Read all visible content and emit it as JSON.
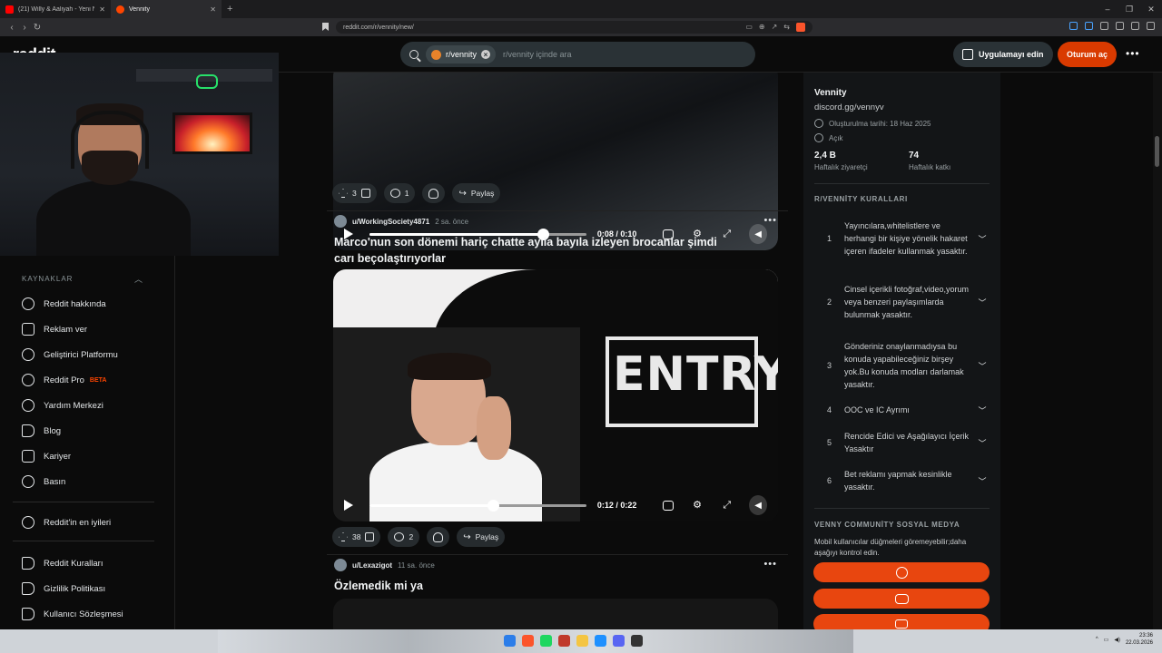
{
  "browser": {
    "tabs": [
      {
        "title": "(21) Willy & Aaliyah - Yeni Nesil Billio",
        "active": false,
        "favicon": "youtube-icon"
      },
      {
        "title": "Vennity",
        "active": true,
        "favicon": "reddit-icon"
      }
    ],
    "url": "reddit.com/r/vennity/new/"
  },
  "header": {
    "logo": "reddit",
    "search_chip": "r/vennity",
    "search_placeholder": "r/vennity içinde ara",
    "get_app": "Uygulamayı edin",
    "login": "Oturum aç"
  },
  "sidebar": {
    "section": "KAYNAKLAR",
    "items": [
      {
        "label": "Reddit hakkında",
        "icon": "reddit-alien-icon"
      },
      {
        "label": "Reklam ver",
        "icon": "megaphone-icon"
      },
      {
        "label": "Geliştirici Platformu",
        "icon": "dev-platform-icon"
      },
      {
        "label": "Reddit Pro",
        "badge": "BETA",
        "icon": "pro-icon"
      },
      {
        "label": "Yardım Merkezi",
        "icon": "help-icon"
      },
      {
        "label": "Blog",
        "icon": "book-icon"
      },
      {
        "label": "Kariyer",
        "icon": "briefcase-icon"
      },
      {
        "label": "Basın",
        "icon": "press-icon"
      }
    ],
    "best_of": "Reddit'in en iyileri",
    "legal": [
      "Reddit Kuralları",
      "Gizlilik Politikası",
      "Kullanıcı Sözleşmesi"
    ]
  },
  "posts": [
    {
      "time": "0:08 / 0:10",
      "progress": 0.8,
      "votes": "3",
      "comments": "1",
      "share": "Paylaş"
    },
    {
      "author": "u/WorkingSociety4871",
      "age": "2 sa. önce",
      "title": "Marco'nun son dönemi hariç chatte ayıla bayıla izleyen brocanlar şimdi carı beçolaştırıyorlar",
      "video_text": "ENTRY",
      "time": "0:12 / 0:22",
      "progress": 0.57,
      "votes": "38",
      "comments": "2",
      "share": "Paylaş"
    },
    {
      "author": "u/Lexazigot",
      "age": "11 sa. önce",
      "title": "Özlemedik mi ya"
    }
  ],
  "community": {
    "name": "Vennity",
    "description": "discord.gg/vennyv",
    "created": "Oluşturulma tarihi: 18 Haz 2025",
    "visibility": "Açık",
    "stats": [
      {
        "value": "2,4 B",
        "label": "Haftalık ziyaretçi"
      },
      {
        "value": "74",
        "label": "Haftalık katkı"
      }
    ],
    "rules_heading": "R/VENNİTY KURALLARI",
    "rules": [
      {
        "num": "1",
        "text": "Yayıncılara,whitelistlere ve herhangi bir kişiye yönelik hakaret içeren ifadeler kullanmak yasaktır."
      },
      {
        "num": "2",
        "text": "Cinsel içerikli fotoğraf,video,yorum veya benzeri paylaşımlarda bulunmak yasaktır."
      },
      {
        "num": "3",
        "text": "Gönderiniz onaylanmadıysa bu konuda yapabileceğiniz birşey yok.Bu konuda modları darlamak yasaktır."
      },
      {
        "num": "4",
        "text": "OOC ve IC Ayrımı"
      },
      {
        "num": "5",
        "text": "Rencide Edici ve Aşağılayıcı İçerik Yasaktır"
      },
      {
        "num": "6",
        "text": "Bet reklamı yapmak kesinlikle yasaktır."
      }
    ],
    "social_heading": "VENNY COMMUNİTY SOSYAL MEDYA",
    "social_note": "Mobil kullanıcılar düğmeleri göremeyebilir;daha aşağıyı kontrol edin.",
    "social_buttons": [
      "globe-icon",
      "discord-icon",
      "youtube-icon"
    ]
  },
  "taskbar": {
    "time": "23:36",
    "date": "22.03.2026"
  }
}
